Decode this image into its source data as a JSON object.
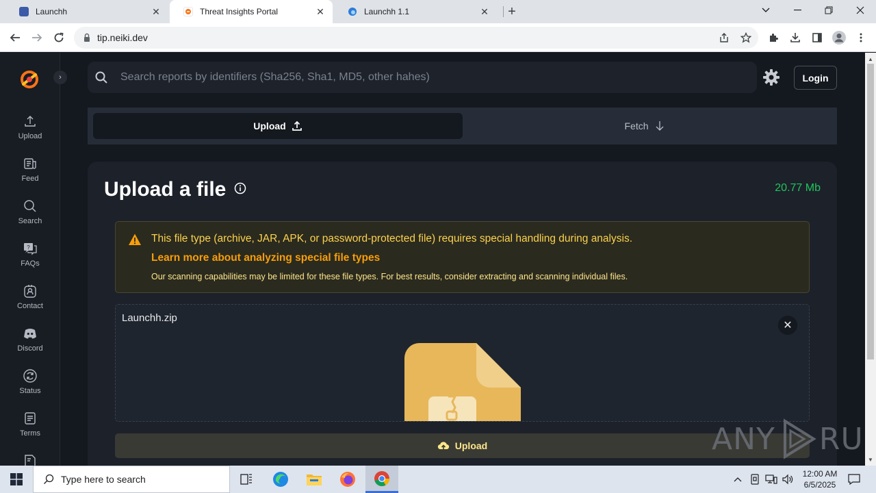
{
  "browser": {
    "tabs": [
      {
        "label": "Launchh",
        "active": false
      },
      {
        "label": "Threat Insights Portal",
        "active": true
      },
      {
        "label": "Launchh 1.1",
        "active": false
      }
    ],
    "url": "tip.neiki.dev"
  },
  "sidebar": {
    "items": [
      {
        "label": "Upload",
        "icon": "upload-icon"
      },
      {
        "label": "Feed",
        "icon": "feed-icon"
      },
      {
        "label": "Search",
        "icon": "search-icon"
      },
      {
        "label": "FAQs",
        "icon": "faq-icon"
      },
      {
        "label": "Contact",
        "icon": "contact-icon"
      },
      {
        "label": "Discord",
        "icon": "discord-icon"
      },
      {
        "label": "Status",
        "icon": "status-icon"
      },
      {
        "label": "Terms",
        "icon": "terms-icon"
      }
    ]
  },
  "header": {
    "search_placeholder": "Search reports by identifiers (Sha256, Sha1, MD5, other hahes)",
    "login_label": "Login"
  },
  "modes": {
    "upload_label": "Upload",
    "fetch_label": "Fetch"
  },
  "card": {
    "title": "Upload a file",
    "size": "20.77 Mb",
    "warning": {
      "line1": "This file type (archive, JAR, APK, or password-protected file) requires special handling during analysis.",
      "link": "Learn more about analyzing special file types",
      "line3": "Our scanning capabilities may be limited for these file types. For best results, consider extracting and scanning individual files."
    },
    "file_name": "Launchh.zip",
    "upload_button": "Upload"
  },
  "watermark": {
    "left": "ANY",
    "right": "RUN"
  },
  "taskbar": {
    "search_placeholder": "Type here to search",
    "time": "12:00 AM",
    "date": "6/5/2025"
  },
  "colors": {
    "accent_green": "#22c55e",
    "warning_yellow": "#fcd34d",
    "warning_link": "#f59e0b",
    "page_bg": "#14181f"
  }
}
